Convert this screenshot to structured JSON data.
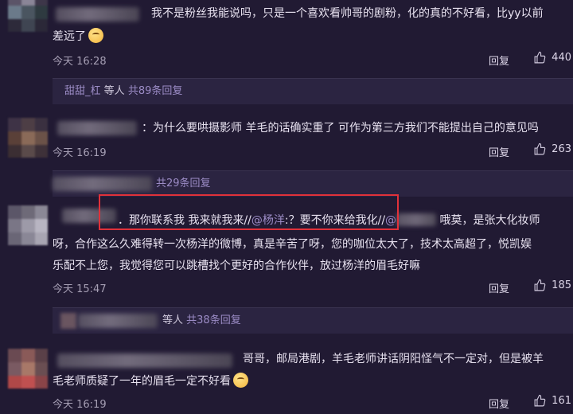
{
  "comments": [
    {
      "line1": "我不是粉丝我能说吗，只是一个喜欢看帅哥的剧粉，化的真的不好看，比yy以前",
      "line2": "差远了",
      "time": "今天 16:28",
      "reply_label": "回复",
      "likes": "440"
    },
    {
      "line1": "：为什么要哄摄影师 羊毛的话确实重了 可作为第三方我们不能提出自己的意见吗",
      "time": "今天 16:19",
      "reply_label": "回复",
      "likes": "263"
    },
    {
      "line1_a": "．那你联系我 我来就我来//",
      "mention": "@杨洋",
      "line1_b": ":？要不你来给我化//",
      "mention2": "@",
      "line1_c": "哦莫，是张大化妆师",
      "line2": "呀，合作这么久难得转一次杨洋的微博，真是辛苦了呀，您的咖位太大了，技术太高超了，悦凯娱",
      "line3": "乐配不上您，我觉得您可以跳槽找个更好的合作伙伴，放过杨洋的眉毛好嘛",
      "time": "今天 15:47",
      "reply_label": "回复",
      "likes": "185"
    },
    {
      "line1": "哥哥，邮局港剧，羊毛老师讲话阴阳怪气不一定对，但是被羊",
      "line2": "毛老师质疑了一年的眉毛一定不好看",
      "time": "今天 16:19",
      "reply_label": "回复",
      "likes": "161"
    }
  ],
  "sub_threads": [
    {
      "names": "甜甜_杠",
      "suffix": "等人",
      "count": "共89条回复"
    },
    {
      "count": "共29条回复"
    },
    {
      "suffix": "等人",
      "count": "共38条回复"
    }
  ],
  "colors": {
    "background": "#211a33",
    "sub_thread_bg": "#2b2441",
    "link": "#9c8cc6",
    "highlight_box": "#e0313a"
  },
  "icons": [
    "thumbs-up-icon",
    "emoji-icon"
  ]
}
